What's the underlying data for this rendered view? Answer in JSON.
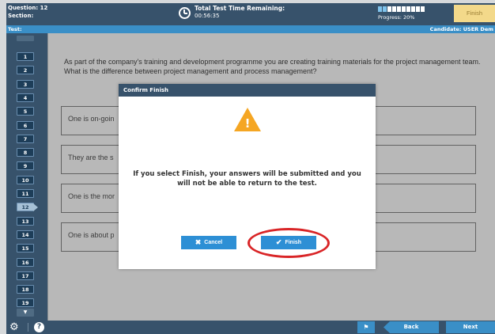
{
  "header": {
    "question_label": "Question: 12",
    "section_label": "Section:",
    "timer_title": "Total Test Time Remaining:",
    "timer_value": "00:56:35",
    "progress_label": "Progress: 20%",
    "progress_fraction": 0.2,
    "finish_label": "Finish"
  },
  "info_strip": {
    "test_label": "Test:",
    "candidate_label": "Candidate: USER Dem"
  },
  "sidebar": {
    "questions": [
      "1",
      "2",
      "3",
      "4",
      "5",
      "6",
      "7",
      "8",
      "9",
      "10",
      "11",
      "12",
      "13",
      "14",
      "15",
      "16",
      "17",
      "18",
      "19"
    ],
    "current": "12"
  },
  "question": {
    "text": "As part of the company's training and development programme you are creating training materials for the project management team. What is the difference between project management and process management?",
    "answers": [
      "One is on-goin",
      "They are the s",
      "One is the mor",
      "One is about p"
    ]
  },
  "modal": {
    "title": "Confirm Finish",
    "warning_icon": "warning-triangle-icon",
    "message": "If you select Finish, your answers will be submitted and you will not be able to return to the test.",
    "cancel_label": "Cancel",
    "finish_label": "Finish",
    "highlight_color": "#d92527"
  },
  "footer": {
    "back_label": "Back",
    "next_label": "Next"
  },
  "colors": {
    "header_bg": "#37526b",
    "accent_blue": "#3a8fc7",
    "button_blue": "#2d8fd5",
    "finish_top_bg": "#f3d98a",
    "warning": "#f5a623"
  }
}
